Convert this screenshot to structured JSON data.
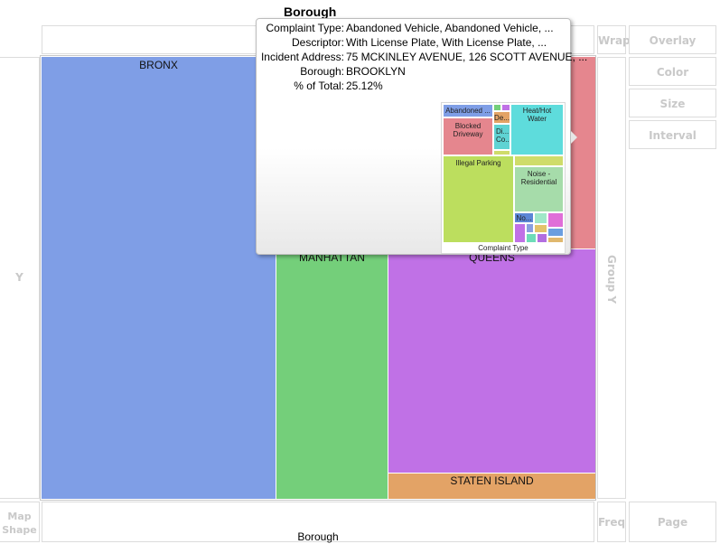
{
  "window": {
    "title": "Borough"
  },
  "zones": {
    "wrap": "Wrap",
    "overlay": "Overlay",
    "color": "Color",
    "size": "Size",
    "interval": "Interval",
    "y": "Y",
    "group_y": "Group Y",
    "map_shape": "Map Shape",
    "freq": "Freq",
    "page": "Page",
    "x": "Borough"
  },
  "tiles": [
    {
      "label": "BRONX",
      "color": "#7f9ee6"
    },
    {
      "label": "MANHATTAN",
      "color": "#74cf7a"
    },
    {
      "label": "QUEENS",
      "color": "#c071e6"
    },
    {
      "label": "STATEN ISLAND",
      "color": "#e3a366"
    },
    {
      "label": "",
      "color": "#e5868e"
    }
  ],
  "tooltip": {
    "rows": [
      {
        "key": "Complaint Type:",
        "value": "Abandoned Vehicle, Abandoned Vehicle, ..."
      },
      {
        "key": "Descriptor:",
        "value": "With License Plate, With License Plate, ..."
      },
      {
        "key": "Incident Address:",
        "value": "75 MCKINLEY AVENUE, 126 SCOTT AVENUE, ..."
      },
      {
        "key": "Borough:",
        "value": "BROOKLYN"
      },
      {
        "key": "% of Total:",
        "value": "25.12%"
      }
    ],
    "mini_chart": {
      "caption": "Complaint Type",
      "tiles": [
        {
          "label": "Abandoned ...",
          "color": "#7f9ee6"
        },
        {
          "label": "",
          "color": "#74cf7a"
        },
        {
          "label": "",
          "color": "#c071e6"
        },
        {
          "label": "De...",
          "color": "#e3a366"
        },
        {
          "label": "Blocked Driveway",
          "color": "#e5868e"
        },
        {
          "label": "Di... Co...",
          "color": "#5fd3d3"
        },
        {
          "label": "",
          "color": "#cfdc6a"
        },
        {
          "label": "Heat/Hot Water",
          "color": "#5edcdc"
        },
        {
          "label": "Illegal Parking",
          "color": "#bcde5e"
        },
        {
          "label": "",
          "color": "#cfdc6a"
        },
        {
          "label": "Noise - Residential",
          "color": "#a6dcaa"
        },
        {
          "label": "No...",
          "color": "#5b86d6"
        },
        {
          "label": "",
          "color": "#c071e6"
        },
        {
          "label": "",
          "color": "#a0e8c8"
        },
        {
          "label": "",
          "color": "#e06ed8"
        },
        {
          "label": "",
          "color": "#8a9fe0"
        },
        {
          "label": "",
          "color": "#e3c36a"
        },
        {
          "label": "",
          "color": "#6a9ee0"
        },
        {
          "label": "",
          "color": "#6edcb8"
        },
        {
          "label": "",
          "color": "#b26ee0"
        },
        {
          "label": "",
          "color": "#e0b86e"
        }
      ]
    }
  }
}
